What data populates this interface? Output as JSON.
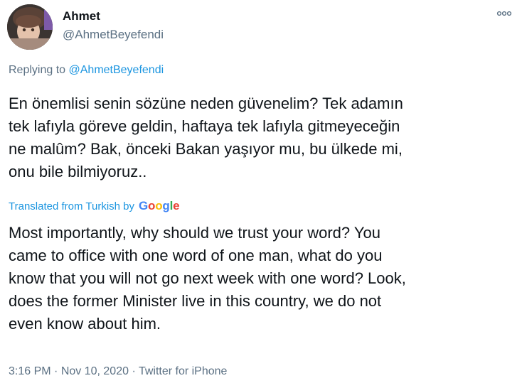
{
  "user": {
    "name": "Ahmet",
    "handle": "@AhmetBeyefendi"
  },
  "reply": {
    "prefix": "Replying to",
    "mention": "@AhmetBeyefendi"
  },
  "original_text": [
    "En önemlisi senin sözüne neden güvenelim? Tek adamın",
    "tek lafıyla göreve geldin, haftaya tek lafıyla gitmeyeceğin",
    "ne malûm? Bak, önceki Bakan yaşıyor mu, bu ülkede mi,",
    "onu bile bilmiyoruz.."
  ],
  "translation": {
    "label": "Translated from Turkish by",
    "provider_letters": [
      "G",
      "o",
      "o",
      "g",
      "l",
      "e"
    ],
    "provider_colors": [
      "#4285f4",
      "#ea4335",
      "#fbbc05",
      "#4285f4",
      "#34a853",
      "#ea4335"
    ],
    "lines": [
      "Most importantly, why should we trust your word? You",
      "came to office with one word of one man, what do you",
      "know that you will not go next week with one word? Look,",
      "does the former Minister live in this country, we do not",
      "even know about him."
    ]
  },
  "meta": {
    "time": "3:16 PM",
    "separator": " · ",
    "date": "Nov 10, 2020",
    "source": "Twitter for iPhone"
  },
  "colors": {
    "link": "#1b95e0",
    "secondary": "#5b7083",
    "text": "#0f1419"
  },
  "icons": {
    "more": "more-icon",
    "avatar": "avatar"
  }
}
